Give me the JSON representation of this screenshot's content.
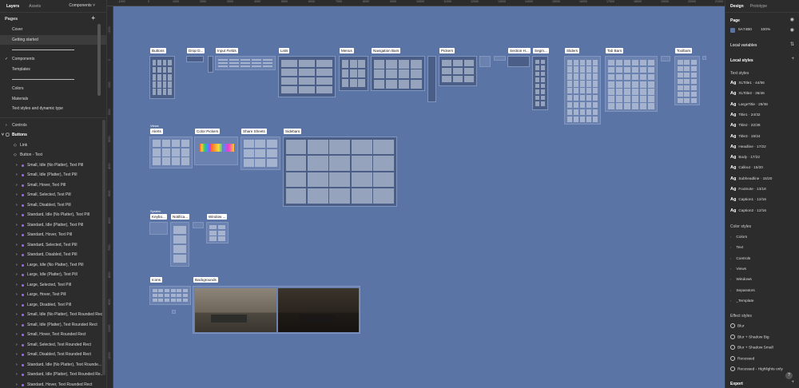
{
  "left_panel": {
    "tabs": [
      "Layers",
      "Assets"
    ],
    "page_select": "Components",
    "pages_title": "Pages",
    "pages": [
      "Cover",
      "Getting started",
      "Components",
      "Templates",
      "Colors",
      "Materials",
      "Text styles and dynamic type"
    ],
    "layers": [
      "Controls",
      "Buttons",
      "Link",
      "Button - Text",
      "Small, Idle (No Platter), Text Pill",
      "Small, Idle (Platter), Text Pill",
      "Small, Hover, Text Pill",
      "Small, Selected, Text Pill",
      "Small, Disabled, Text Pill",
      "Standard, Idle (No Platter), Text Pill",
      "Standard, Idle (Platter), Text Pill",
      "Standard, Hover, Text Pill",
      "Standard, Selected, Text Pill",
      "Standard, Disabled, Text Pill",
      "Large, Idle (No Platter), Text Pill",
      "Large, Idle (Platter), Text Pill",
      "Large, Selected, Text Pill",
      "Large, Hover, Text Pill",
      "Large, Disabled, Text Pill",
      "Small, Idle (No Platter), Text Rounded Rect",
      "Small, Idle (Platter), Text Rounded Rect",
      "Small, Hover, Text Rounded Rect",
      "Small, Selected, Text Rounded Rect",
      "Small, Disabled, Text Rounded Rect",
      "Standard, Idle (No Platter), Text Rounde...",
      "Standard, Idle (Platter), Text Rounded Re...",
      "Standard, Hover, Text Rounded Rect"
    ]
  },
  "canvas": {
    "ruler_h": [
      "-1000",
      "0",
      "1000",
      "2000",
      "3000",
      "4000",
      "5000",
      "6000",
      "7000",
      "8000",
      "9000",
      "10000",
      "11000",
      "12000",
      "13000",
      "14000",
      "15000",
      "16000",
      "17000",
      "18000",
      "19000",
      "20000",
      "21000"
    ],
    "ruler_v": [
      "-1000",
      "0",
      "1000",
      "2000",
      "3000",
      "4000",
      "5000",
      "6000",
      "7000",
      "8000",
      "9000",
      "10000",
      "11000"
    ],
    "frame_labels": {
      "buttons": "Buttons",
      "dropdown": "Drop D...",
      "input_fields": "Input Fields",
      "lists": "Lists",
      "menus": "Menus",
      "navigation_bars": "Navigation Bars",
      "pickers": "Pickers",
      "section": "Section H...",
      "segmented": "Segm...",
      "sliders": "Sliders",
      "tab_bars": "Tab Bars",
      "toolbars": "Toolbars",
      "alerts": "Alerts",
      "color_pickers": "Color Pickers",
      "share_sheets": "Share Sheets",
      "sidebars": "Sidebars",
      "keyboard": "Keybo...",
      "notifications": "Notifica...",
      "window": "Window ...",
      "icons": "Icons",
      "backgrounds": "Backgrounds"
    },
    "section_tags": {
      "views": "Views",
      "system": "System"
    }
  },
  "right_panel": {
    "tabs": [
      "Design",
      "Prototype"
    ],
    "page_title": "Page",
    "page_color": "5A74B0",
    "page_opacity": "100%",
    "local_variables": "Local variables",
    "local_styles": "Local styles",
    "text_styles_title": "Text styles",
    "text_styles": [
      {
        "ag": "Ag",
        "label": "XLTitle1 · 44/56"
      },
      {
        "ag": "Ag",
        "label": "XLTitle2 · 36/46"
      },
      {
        "ag": "Ag",
        "label": "LargeTitle · 29/38"
      },
      {
        "ag": "Ag",
        "label": "Title1 · 24/32"
      },
      {
        "ag": "Ag",
        "label": "Title2 · 22/28"
      },
      {
        "ag": "Ag",
        "label": "Title3 · 19/24"
      },
      {
        "ag": "Ag",
        "label": "Headline · 17/22"
      },
      {
        "ag": "Ag",
        "label": "Body · 17/22"
      },
      {
        "ag": "Ag",
        "label": "Callout · 15/20"
      },
      {
        "ag": "Ag",
        "label": "Subheadline · 15/20"
      },
      {
        "ag": "Ag",
        "label": "Footnote · 13/18"
      },
      {
        "ag": "Ag",
        "label": "Caption1 · 12/16"
      },
      {
        "ag": "Ag",
        "label": "Caption2 · 12/16"
      }
    ],
    "color_styles_title": "Color styles",
    "color_styles": [
      "Colors",
      "Text",
      "Controls",
      "Views",
      "Windows",
      "Separators",
      "_Template"
    ],
    "effect_styles_title": "Effect styles",
    "effect_styles": [
      "Blur",
      "Blur + Shadow Big",
      "Blur + Shadow Small",
      "Recessed",
      "Recessed - Highlights only"
    ],
    "export": "Export",
    "help": "?"
  },
  "colors": {
    "canvas_bg": "#5a74a6",
    "panel_bg": "#2c2c2c",
    "accent": "#9b6cf0"
  }
}
